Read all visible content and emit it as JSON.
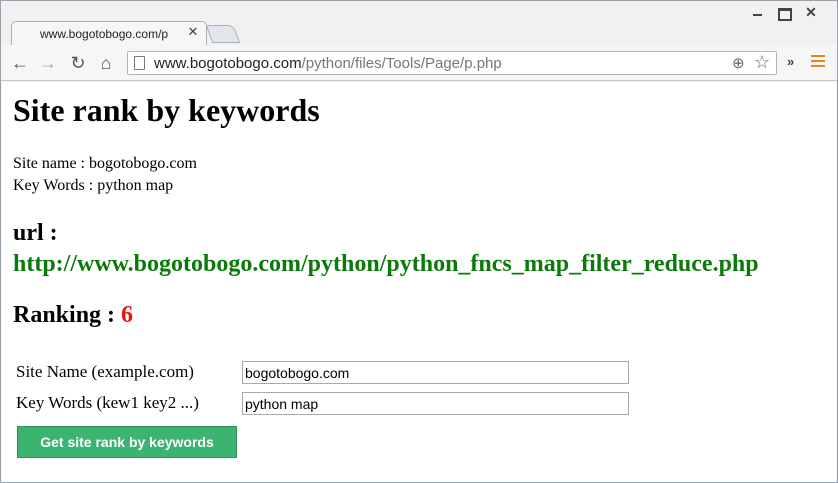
{
  "browser": {
    "tab_title": "www.bogotobogo.com/p",
    "tab_close_icon": "close-icon",
    "url_host": "www.bogotobogo.com",
    "url_path": "/python/files/Tools/Page/p.php",
    "icons": {
      "back": "arrow-left-icon",
      "forward": "arrow-right-icon",
      "reload": "reload-icon",
      "home": "home-icon",
      "page": "page-icon",
      "zoom": "zoom-icon",
      "star": "star-icon",
      "extensions": "chevron-double-right-icon",
      "menu": "hamburger-menu-icon"
    },
    "menu_color": "#e08a1e"
  },
  "page": {
    "title": "Site rank by keywords",
    "site_name_line": "Site name : bogotobogo.com",
    "keywords_line": "Key Words : python map",
    "url_label": "url :",
    "result_url": "http://www.bogotobogo.com/python/python_fncs_map_filter_reduce.php",
    "ranking_label": "Ranking :",
    "ranking_value": "6"
  },
  "form": {
    "site_label": "Site Name (example.com)",
    "site_value": "bogotobogo.com",
    "keywords_label": "Key Words (kew1 key2 ...)",
    "keywords_value": "python map",
    "submit_label": "Get site rank by keywords",
    "submit_color": "#3cb371"
  },
  "colors": {
    "link": "#0b7a0b",
    "rank": "#ee1111"
  }
}
